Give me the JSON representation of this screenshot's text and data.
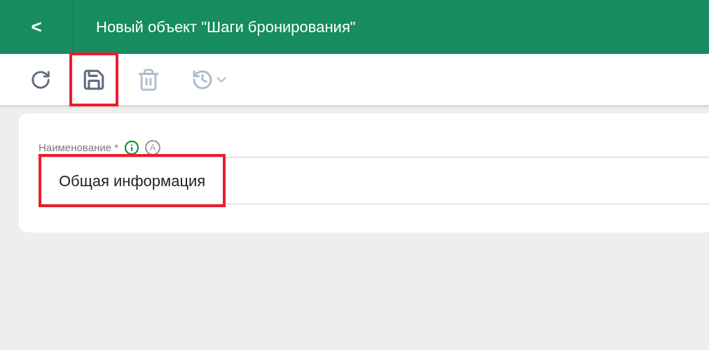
{
  "header": {
    "back": "<",
    "title": "Новый объект \"Шаги бронирования\""
  },
  "toolbar": [
    {
      "kind": "refresh",
      "disabled": false,
      "highlighted": false
    },
    {
      "kind": "save",
      "disabled": false,
      "highlighted": true
    },
    {
      "kind": "delete",
      "disabled": true,
      "highlighted": false
    },
    {
      "kind": "history",
      "disabled": true,
      "highlighted": false
    }
  ],
  "field": {
    "label": "Наименование *",
    "badge": "A",
    "value": "Общая информация",
    "highlighted": true
  }
}
